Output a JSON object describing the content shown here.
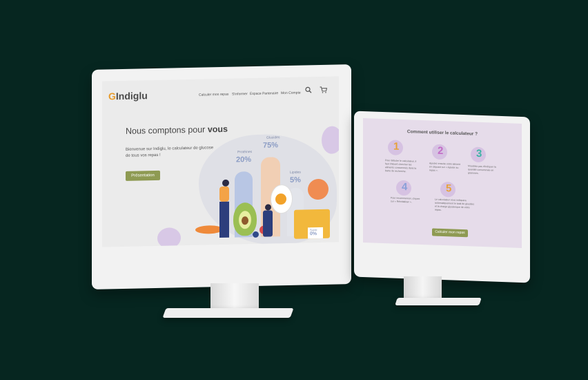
{
  "left_screen": {
    "brand": {
      "prefix": "G",
      "name": "Indiglu"
    },
    "nav": [
      "Calculer mon repas",
      "S'informer",
      "Espace Partenaire",
      "Mon Compte"
    ],
    "icons": [
      "search-icon",
      "cart-icon"
    ],
    "hero": {
      "title_plain": "Nous comptons pour ",
      "title_bold": "vous",
      "subtitle": "Bienvenue sur Indiglu, le calculateur de glucose de tous vos repas !",
      "button": "Présentation"
    },
    "illustration": {
      "stats": [
        {
          "label": "Protéines",
          "value": "20%"
        },
        {
          "label": "Glucides",
          "value": "75%"
        },
        {
          "label": "Lipides",
          "value": "5%"
        },
        {
          "label": "Sucre",
          "value": "0%"
        }
      ]
    }
  },
  "right_screen": {
    "title": "Comment utiliser le calculateur ?",
    "steps": [
      {
        "num": "1",
        "text": "Pour débuter le calculateur, il faut d'abord chercher les aliments consommés dans la barre de recherche."
      },
      {
        "num": "2",
        "text": "Ajoutez ensuite votre aliment en cliquant sur « Ajouter au repas »."
      },
      {
        "num": "3",
        "text": "N'oubliez pas d'indiquer la quantité consommée en grammes."
      },
      {
        "num": "4",
        "text": "Pour recommencer, cliquez sur « Réinitialiser »."
      },
      {
        "num": "5",
        "text": "Le calculateur vous indiquera automatiquement le total de glucides et la charge glycémique de votre repas."
      }
    ],
    "button": "Calculer mon repas"
  },
  "colors": {
    "background": "#062620",
    "accent_green": "#8e9a52",
    "lavender": "#e6dcea",
    "orange": "#e89b2a"
  }
}
